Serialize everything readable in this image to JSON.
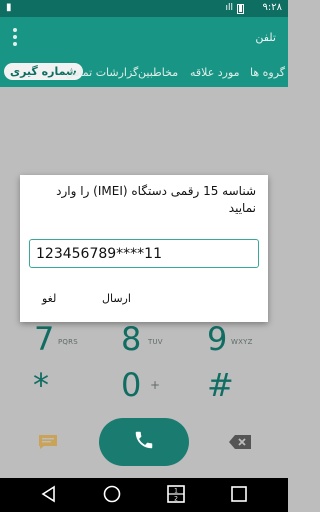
{
  "status_bar": {
    "time": "۹:۲۸",
    "signal": "ıll"
  },
  "app": {
    "title": "تلفن"
  },
  "tabs": [
    {
      "label": "شماره گیری",
      "active": true
    },
    {
      "label": "گزارشات تماس",
      "active": false
    },
    {
      "label": "مخاطبین",
      "active": false
    },
    {
      "label": "مورد علاقه",
      "active": false
    },
    {
      "label": "گروه ها",
      "active": false
    }
  ],
  "dialpad": {
    "row1": [
      {
        "digit": "7",
        "letters": "PQRS"
      },
      {
        "digit": "8",
        "letters": "TUV"
      },
      {
        "digit": "9",
        "letters": "WXYZ"
      }
    ],
    "row2": [
      {
        "digit": "*",
        "letters": ""
      },
      {
        "digit": "0",
        "letters": "+"
      },
      {
        "digit": "#",
        "letters": ""
      }
    ]
  },
  "dialog": {
    "title": "شناسه 15 رقمی دستگاه (IMEI) را وارد نمایید",
    "input_value": "123456789****11",
    "send_label": "ارسال",
    "cancel_label": "لغو"
  },
  "colors": {
    "primary": "#199586",
    "primary_dark": "#0e6e61",
    "accent": "#116d62"
  },
  "icons": {
    "menu": "overflow-menu-icon",
    "message": "message-icon",
    "call": "phone-icon",
    "delete": "backspace-icon",
    "back": "back-icon",
    "home": "home-icon",
    "dual": "dual-window-icon",
    "recent": "recent-apps-icon"
  }
}
